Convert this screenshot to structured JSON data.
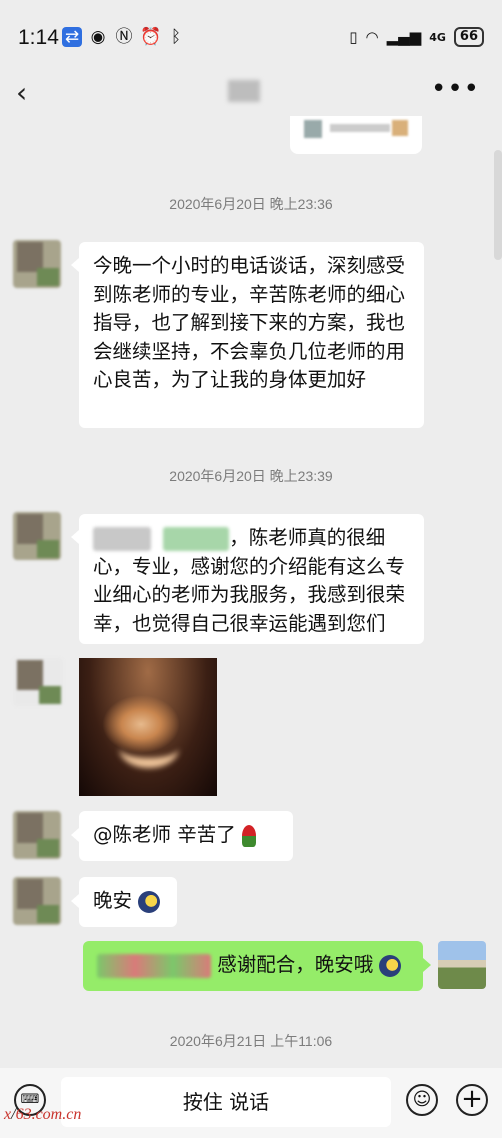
{
  "status_bar": {
    "time": "1:14",
    "battery": "66",
    "network": "4G"
  },
  "header": {
    "back_icon": "chevron-left-icon",
    "more_icon": "more-dots-icon"
  },
  "messages": {
    "ts1": "2020年6月20日 晚上23:36",
    "msg1": "今晚一个小时的电话谈话，深刻感受到陈老师的专业，辛苦陈老师的细心指导，也了解到接下来的方案，我也会继续坚持，不会辜负几位老师的用心良苦，为了让我的身体更加好",
    "ts2": "2020年6月20日 晚上23:39",
    "msg2": "，陈老师真的很细心，专业，感谢您的介绍能有这么专业细心的老师为我服务，我感到很荣幸，也觉得自己很幸运能遇到您们",
    "msg4": "@陈老师  辛苦了",
    "msg5": "晚安",
    "msg6": "感谢配合，晚安哦",
    "ts3": "2020年6月21日 上午11:06"
  },
  "input_bar": {
    "voice_label": "按住 说话"
  },
  "watermark": {
    "brand": "x",
    "text": "63.com.cn",
    "digit": "/"
  },
  "colors": {
    "background": "#ededed",
    "my_bubble": "#95ec69",
    "their_bubble": "#ffffff"
  }
}
